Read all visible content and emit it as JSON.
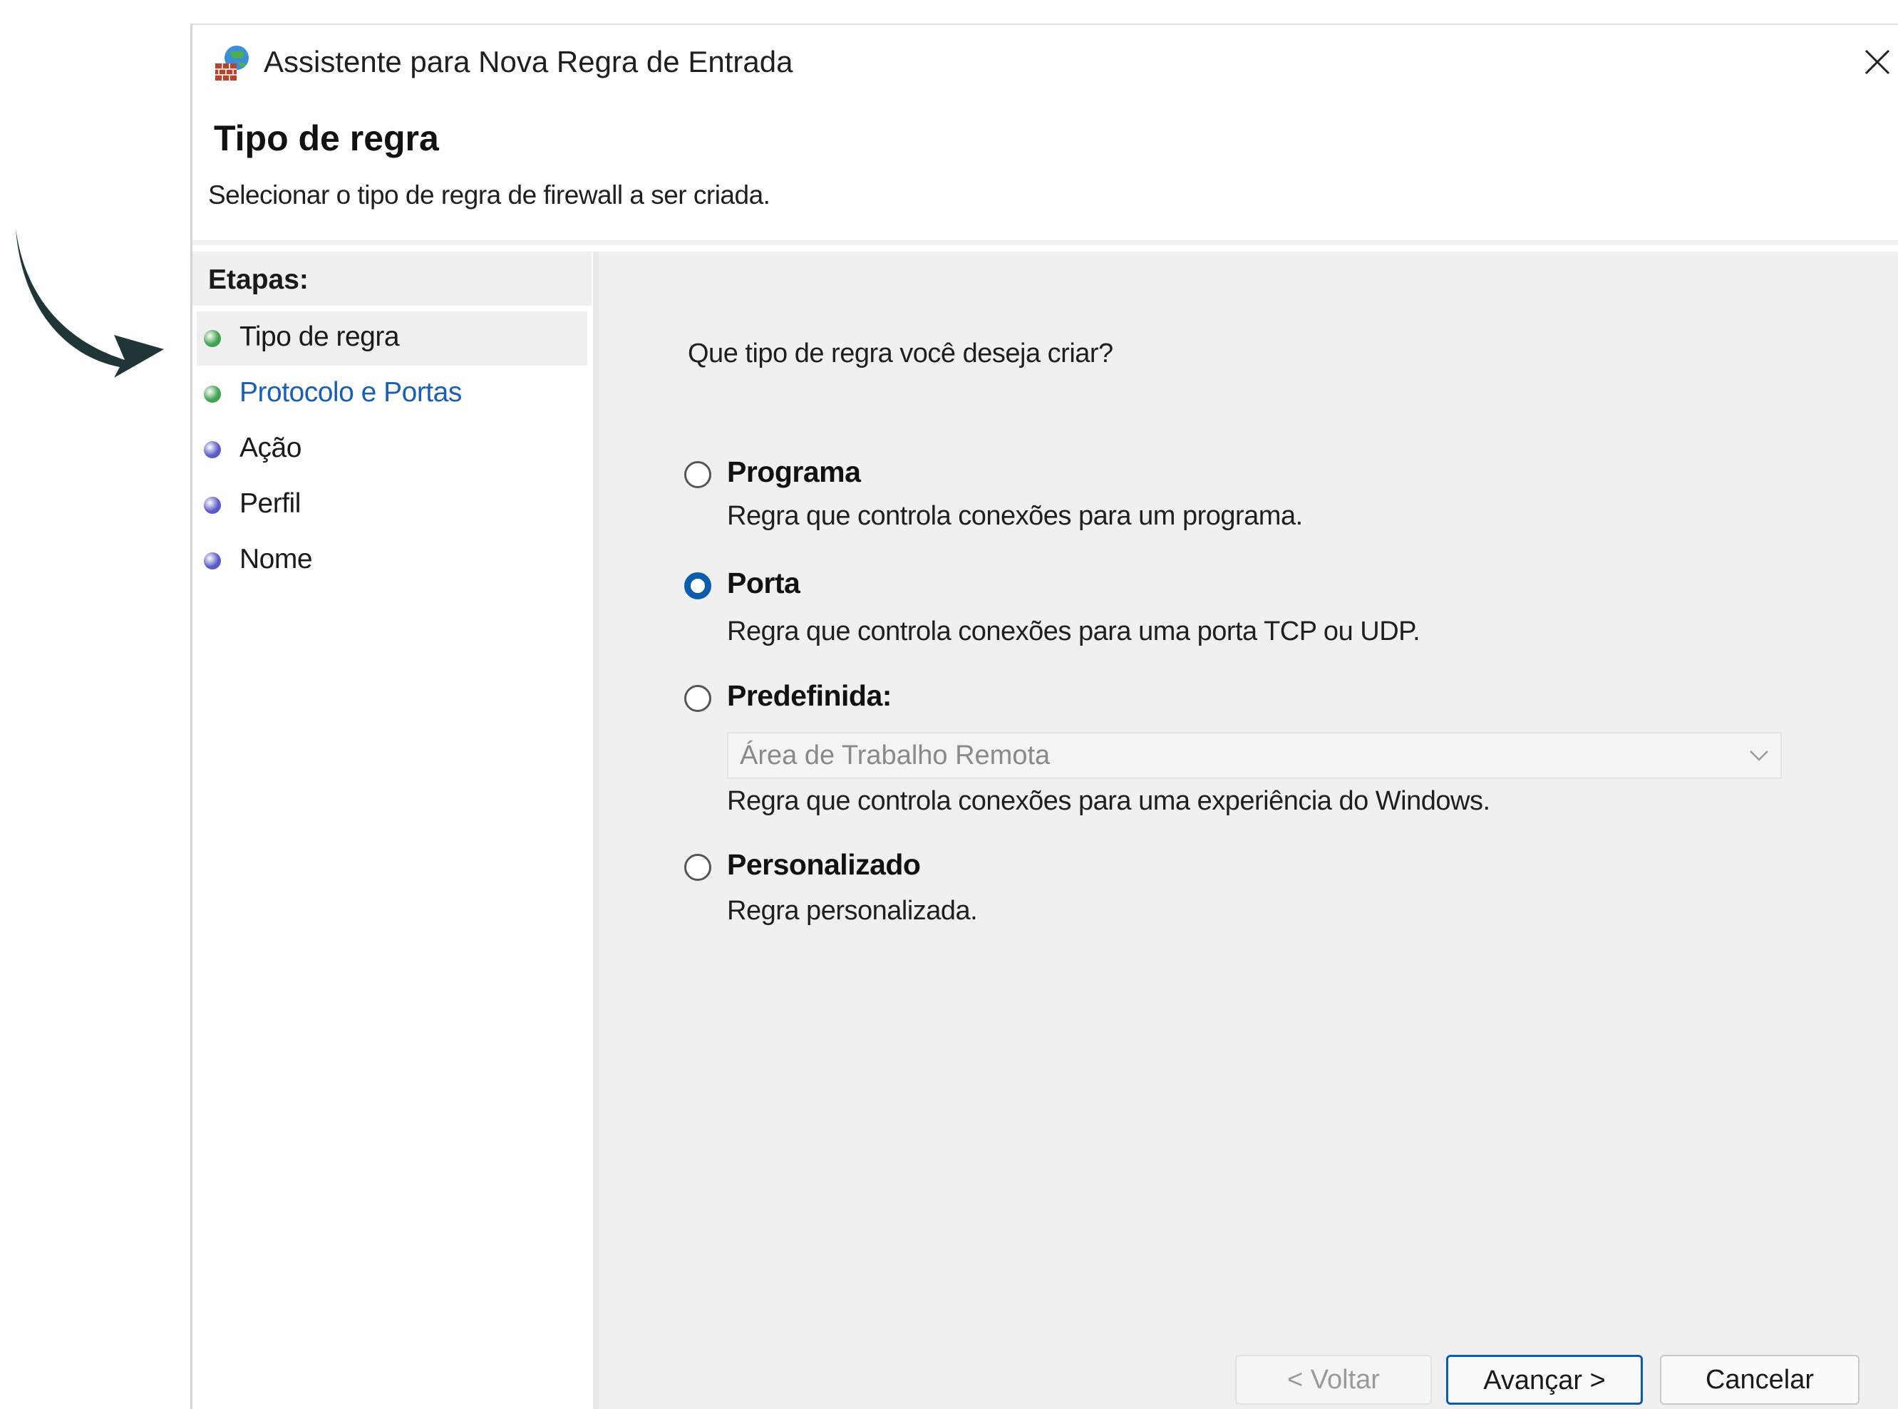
{
  "window": {
    "title": "Assistente para Nova Regra de Entrada",
    "icon": "firewall-globe-icon"
  },
  "header": {
    "title": "Tipo de regra",
    "subtitle": "Selecionar o tipo de regra de firewall a ser criada."
  },
  "steps": {
    "heading": "Etapas:",
    "items": [
      {
        "label": "Tipo de regra",
        "dot_color": "#3fa34d",
        "text_color": "#1a1a1a",
        "active": true
      },
      {
        "label": "Protocolo e Portas",
        "dot_color": "#3fa34d",
        "text_color": "#1a5fb4",
        "active": false
      },
      {
        "label": "Ação",
        "dot_color": "#5b5bc8",
        "text_color": "#1a1a1a",
        "active": false
      },
      {
        "label": "Perfil",
        "dot_color": "#5b5bc8",
        "text_color": "#1a1a1a",
        "active": false
      },
      {
        "label": "Nome",
        "dot_color": "#5b5bc8",
        "text_color": "#1a1a1a",
        "active": false
      }
    ]
  },
  "main": {
    "question": "Que tipo de regra você deseja criar?",
    "options": [
      {
        "label": "Programa",
        "description": "Regra que controla conexões para um programa.",
        "checked": false
      },
      {
        "label": "Porta",
        "description": "Regra que controla conexões para uma porta TCP ou UDP.",
        "checked": true
      },
      {
        "label": "Predefinida:",
        "description": "Regra que controla conexões para uma experiência do Windows.",
        "checked": false
      },
      {
        "label": "Personalizado",
        "description": "Regra personalizada.",
        "checked": false
      }
    ],
    "predefined_select": {
      "value": "Área de Trabalho Remota",
      "enabled": false
    }
  },
  "buttons": {
    "back": "< Voltar",
    "next": "Avançar >",
    "cancel": "Cancelar"
  },
  "colors": {
    "accent": "#0b5cad",
    "arrow": "#1f3538"
  }
}
